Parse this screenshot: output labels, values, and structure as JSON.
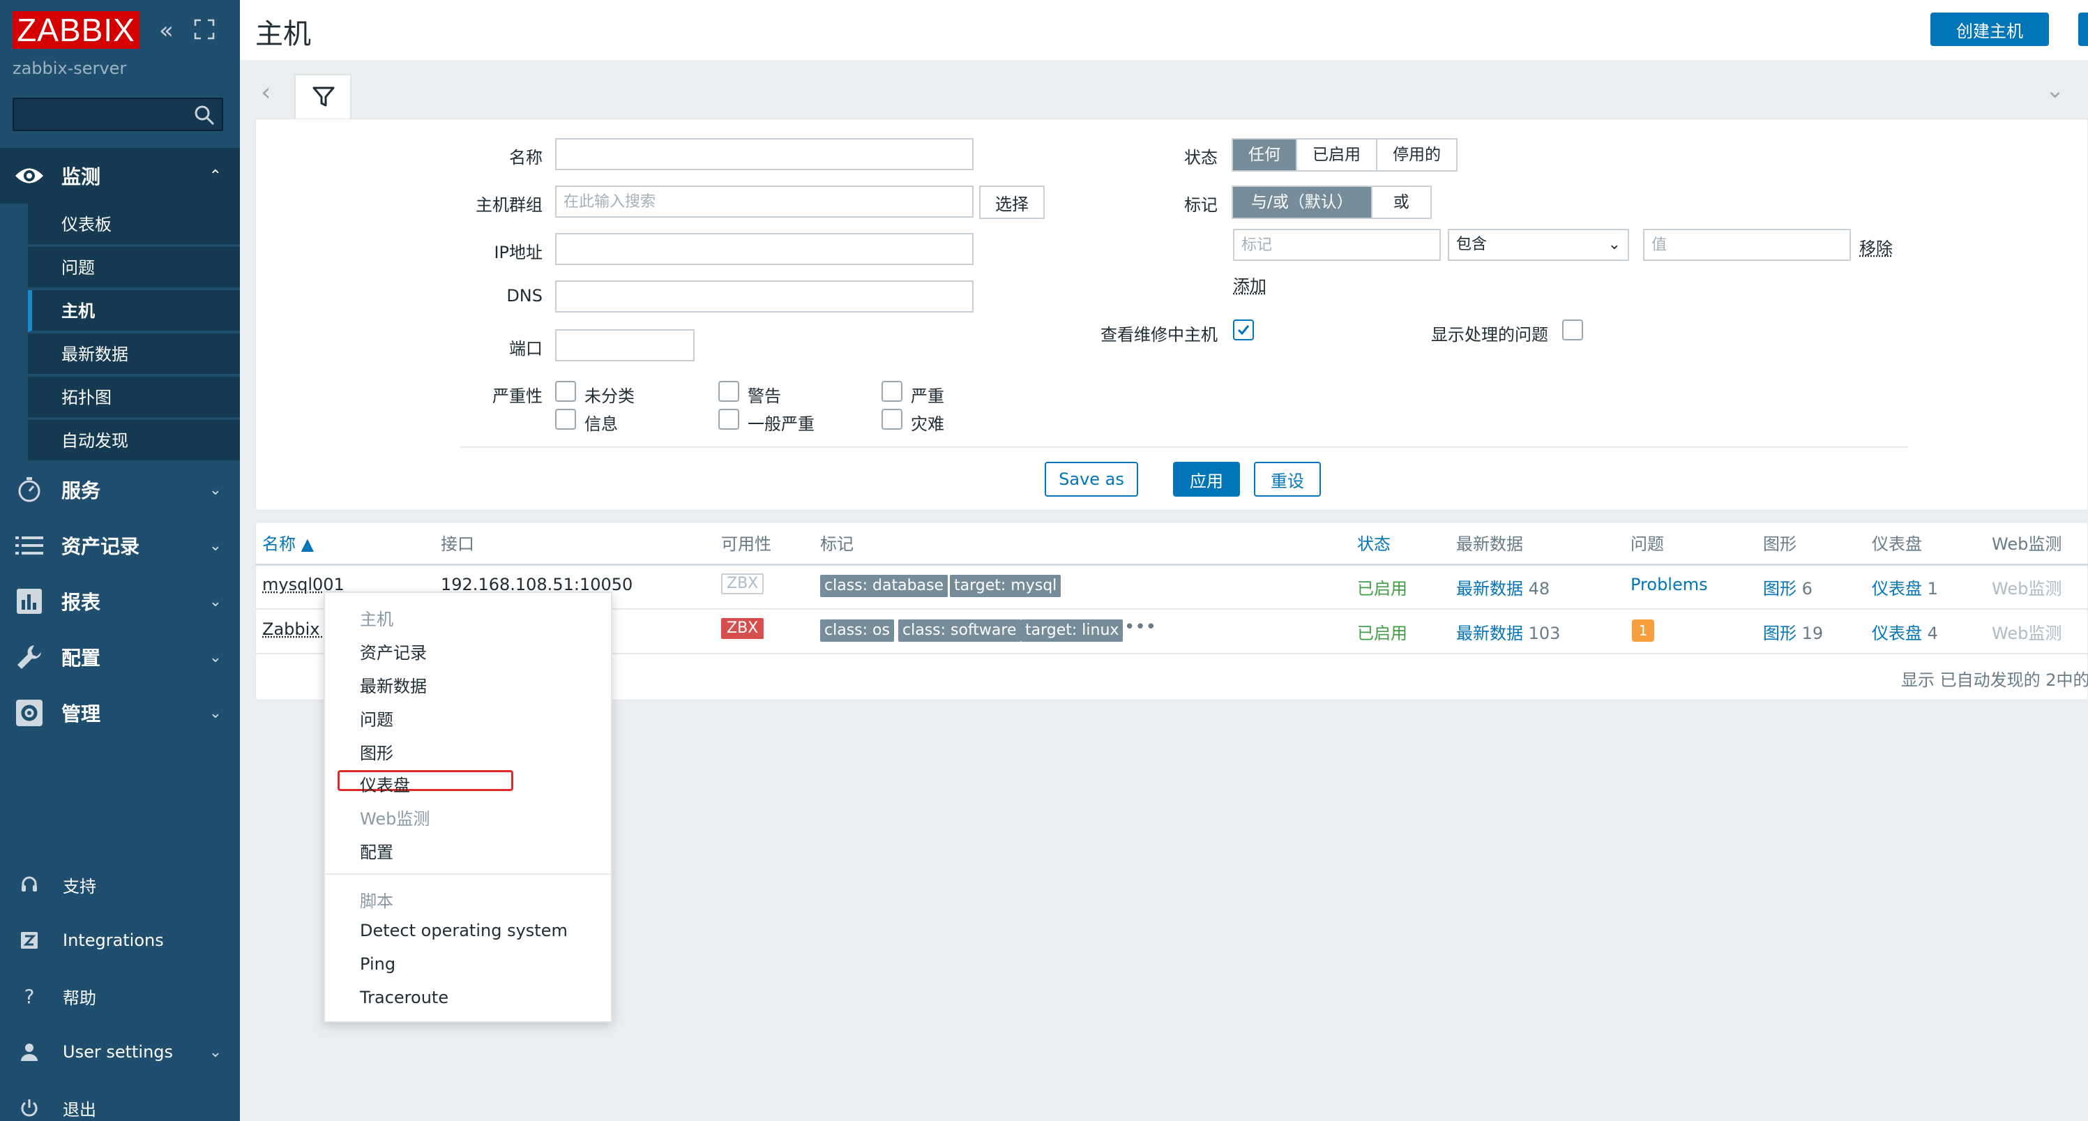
{
  "sidebar": {
    "logo": "ZABBIX",
    "server_name": "zabbix-server",
    "search_placeholder": "",
    "monitor": {
      "label": "监测",
      "items": [
        {
          "label": "仪表板"
        },
        {
          "label": "问题"
        },
        {
          "label": "主机",
          "active": true
        },
        {
          "label": "最新数据"
        },
        {
          "label": "拓扑图"
        },
        {
          "label": "自动发现"
        }
      ]
    },
    "sections": [
      {
        "label": "服务",
        "icon": "stopwatch-icon"
      },
      {
        "label": "资产记录",
        "icon": "list-icon"
      },
      {
        "label": "报表",
        "icon": "bar-chart-icon"
      },
      {
        "label": "配置",
        "icon": "wrench-icon"
      },
      {
        "label": "管理",
        "icon": "gear-icon"
      }
    ],
    "bottom": [
      {
        "label": "支持",
        "icon": "headset-icon"
      },
      {
        "label": "Integrations",
        "icon": "zabbix-z-icon"
      },
      {
        "label": "帮助",
        "icon": "question-icon"
      },
      {
        "label": "User settings",
        "icon": "user-icon"
      },
      {
        "label": "退出",
        "icon": "power-icon"
      }
    ]
  },
  "header": {
    "title": "主机",
    "create_button": "创建主机"
  },
  "filter": {
    "name_label": "名称",
    "name_value": "",
    "hostgroup_label": "主机群组",
    "hostgroup_placeholder": "在此输入搜索",
    "select_button": "选择",
    "ip_label": "IP地址",
    "dns_label": "DNS",
    "port_label": "端口",
    "severity_label": "严重性",
    "severities": [
      "未分类",
      "警告",
      "严重",
      "信息",
      "一般严重",
      "灾难"
    ],
    "status_label": "状态",
    "status_options": [
      "任何",
      "已启用",
      "停用的"
    ],
    "status_selected": "任何",
    "tags_label": "标记",
    "tag_operator_options": [
      "与/或（默认）",
      "或"
    ],
    "tag_placeholder": "标记",
    "tag_condition": "包含",
    "value_placeholder": "值",
    "remove_link": "移除",
    "add_link": "添加",
    "maintenance_label": "查看维修中主机",
    "maintenance_checked": true,
    "suppressed_label": "显示处理的问题",
    "suppressed_checked": false,
    "save_as": "Save as",
    "apply": "应用",
    "reset": "重设"
  },
  "table": {
    "columns": [
      "名称 ▲",
      "接口",
      "可用性",
      "标记",
      "状态",
      "最新数据",
      "问题",
      "图形",
      "仪表盘",
      "Web监测"
    ],
    "rows": [
      {
        "name": "mysql001",
        "interface": "192.168.108.51:10050",
        "availability": "ZBX",
        "availability_state": "unknown",
        "tags": [
          "class: database",
          "target: mysql"
        ],
        "status": "已启用",
        "latest_data": "最新数据",
        "latest_count": "48",
        "problems": "Problems",
        "graphs": "图形",
        "graphs_count": "6",
        "dashboards": "仪表盘",
        "dashboards_count": "1",
        "web": "Web监测"
      },
      {
        "name": "Zabbix s",
        "interface": "",
        "availability": "ZBX",
        "availability_state": "error",
        "tags": [
          "class: os",
          "class: software",
          "target: linux"
        ],
        "more": "•••",
        "status": "已启用",
        "latest_data": "最新数据",
        "latest_count": "103",
        "problems_badge": "1",
        "graphs": "图形",
        "graphs_count": "19",
        "dashboards": "仪表盘",
        "dashboards_count": "4",
        "web": "Web监测"
      }
    ],
    "footer": "显示 已自动发现的 2中的"
  },
  "context_menu": {
    "host_header": "主机",
    "items": [
      "资产记录",
      "最新数据",
      "问题",
      "图形",
      "仪表盘",
      "Web监测",
      "配置"
    ],
    "highlighted": "仪表盘",
    "disabled": [
      "Web监测"
    ],
    "scripts_header": "脚本",
    "scripts": [
      "Detect operating system",
      "Ping",
      "Traceroute"
    ]
  },
  "colors": {
    "sidebar_bg": "#1f4e6e",
    "sidebar_active": "#163a52",
    "primary": "#0275b8",
    "enabled_green": "#429e47",
    "tag_grey": "#768d99",
    "error_red": "#d64e4e",
    "highlight_red": "#e02a2a",
    "logo_red": "#d40000"
  }
}
